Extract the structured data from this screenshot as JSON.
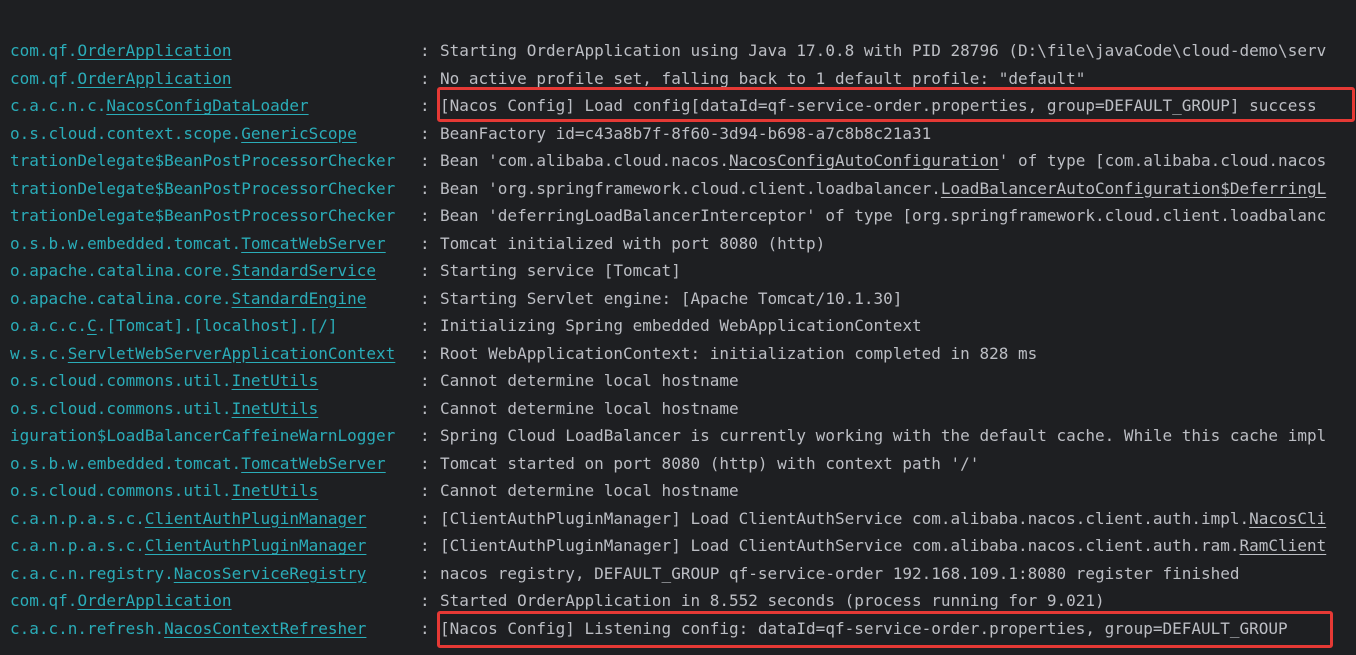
{
  "console": {
    "lines": [
      {
        "logger_prefix": "com.qf.",
        "logger_class": "OrderApplication",
        "separator": ":",
        "message": "Starting OrderApplication using Java 17.0.8 with PID 28796 (D:\\file\\javaCode\\cloud-demo\\serv"
      },
      {
        "logger_prefix": "com.qf.",
        "logger_class": "OrderApplication",
        "separator": ":",
        "message": "No active profile set, falling back to 1 default profile: \"default\""
      },
      {
        "logger_prefix": "c.a.c.n.c.",
        "logger_class": "NacosConfigDataLoader",
        "separator": ":",
        "message": "[Nacos Config] Load config[dataId=qf-service-order.properties, group=DEFAULT_GROUP] success"
      },
      {
        "logger_prefix": "o.s.cloud.context.scope.",
        "logger_class": "GenericScope",
        "separator": ":",
        "message": "BeanFactory id=c43a8b7f-8f60-3d94-b698-a7c8b8c21a31"
      },
      {
        "logger_prefix": "trationDelegate$BeanPostProcessorChecker",
        "logger_class": "",
        "separator": ":",
        "message_pre": "Bean 'com.alibaba.cloud.nacos.",
        "message_link": "NacosConfigAutoConfiguration",
        "message_post": "' of type [com.alibaba.cloud.nacos"
      },
      {
        "logger_prefix": "trationDelegate$BeanPostProcessorChecker",
        "logger_class": "",
        "separator": ":",
        "message_pre": "Bean 'org.springframework.cloud.client.loadbalancer.",
        "message_link": "LoadBalancerAutoConfiguration$DeferringL",
        "message_post": ""
      },
      {
        "logger_prefix": "trationDelegate$BeanPostProcessorChecker",
        "logger_class": "",
        "separator": ":",
        "message": "Bean 'deferringLoadBalancerInterceptor' of type [org.springframework.cloud.client.loadbalanc"
      },
      {
        "logger_prefix": "o.s.b.w.embedded.tomcat.",
        "logger_class": "TomcatWebServer",
        "separator": ":",
        "message": "Tomcat initialized with port 8080 (http)"
      },
      {
        "logger_prefix": "o.apache.catalina.core.",
        "logger_class": "StandardService",
        "separator": ":",
        "message": "Starting service [Tomcat]"
      },
      {
        "logger_prefix": "o.apache.catalina.core.",
        "logger_class": "StandardEngine",
        "separator": ":",
        "message": "Starting Servlet engine: [Apache Tomcat/10.1.30]"
      },
      {
        "logger_prefix": "o.a.c.c.",
        "logger_class": "C",
        "logger_suffix": ".[Tomcat].[localhost].[/]",
        "separator": ":",
        "message": "Initializing Spring embedded WebApplicationContext"
      },
      {
        "logger_prefix": "w.s.c.",
        "logger_class": "ServletWebServerApplicationContext",
        "separator": ":",
        "message": "Root WebApplicationContext: initialization completed in 828 ms"
      },
      {
        "logger_prefix": "o.s.cloud.commons.util.",
        "logger_class": "InetUtils",
        "separator": ":",
        "message": "Cannot determine local hostname"
      },
      {
        "logger_prefix": "o.s.cloud.commons.util.",
        "logger_class": "InetUtils",
        "separator": ":",
        "message": "Cannot determine local hostname"
      },
      {
        "logger_prefix": "iguration$LoadBalancerCaffeineWarnLogger",
        "logger_class": "",
        "separator": ":",
        "message": "Spring Cloud LoadBalancer is currently working with the default cache. While this cache impl"
      },
      {
        "logger_prefix": "o.s.b.w.embedded.tomcat.",
        "logger_class": "TomcatWebServer",
        "separator": ":",
        "message": "Tomcat started on port 8080 (http) with context path '/'"
      },
      {
        "logger_prefix": "o.s.cloud.commons.util.",
        "logger_class": "InetUtils",
        "separator": ":",
        "message": "Cannot determine local hostname"
      },
      {
        "logger_prefix": "c.a.n.p.a.s.c.",
        "logger_class": "ClientAuthPluginManager",
        "separator": ":",
        "message_pre": "[ClientAuthPluginManager] Load ClientAuthService com.alibaba.nacos.client.auth.impl.",
        "message_link": "NacosCli",
        "message_post": ""
      },
      {
        "logger_prefix": "c.a.n.p.a.s.c.",
        "logger_class": "ClientAuthPluginManager",
        "separator": ":",
        "message_pre": "[ClientAuthPluginManager] Load ClientAuthService com.alibaba.nacos.client.auth.ram.",
        "message_link": "RamClient",
        "message_post": ""
      },
      {
        "logger_prefix": "c.a.c.n.registry.",
        "logger_class": "NacosServiceRegistry",
        "separator": ":",
        "message": "nacos registry, DEFAULT_GROUP qf-service-order 192.168.109.1:8080 register finished"
      },
      {
        "logger_prefix": "com.qf.",
        "logger_class": "OrderApplication",
        "separator": ":",
        "message": "Started OrderApplication in 8.552 seconds (process running for 9.021)"
      },
      {
        "logger_prefix": "c.a.c.n.refresh.",
        "logger_class": "NacosContextRefresher",
        "separator": ":",
        "message": "[Nacos Config] Listening config: dataId=qf-service-order.properties, group=DEFAULT_GROUP"
      }
    ],
    "colors": {
      "background": "#1e1f22",
      "text": "#bcbec4",
      "logger": "#2aacb8",
      "highlight": "#e53935"
    }
  }
}
